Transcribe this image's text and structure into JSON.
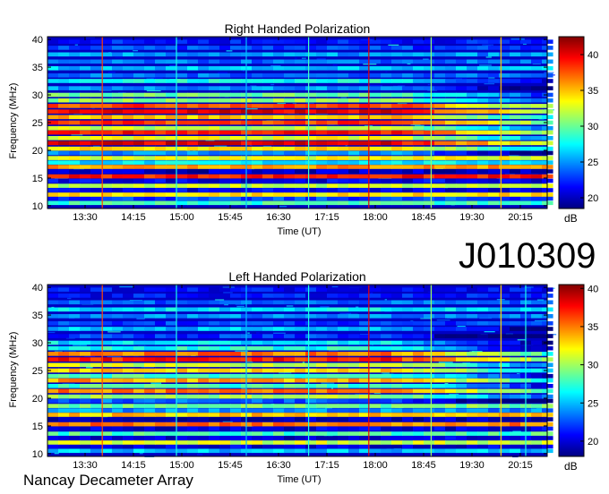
{
  "observation_id": "J010309",
  "footer": "Nancay Decameter Array",
  "colors": {
    "colormap": [
      "#00007f",
      "#0000ff",
      "#007fff",
      "#00ffff",
      "#7fff7f",
      "#ffff00",
      "#ff7f00",
      "#ff0000",
      "#7f0000"
    ]
  },
  "chart_data": [
    {
      "type": "heatmap",
      "title": "Right Handed Polarization",
      "xlabel": "Time (UT)",
      "ylabel": "Frequency (MHz)",
      "colorbar_label": "dB",
      "x_ticks": [
        "13:30",
        "14:15",
        "15:00",
        "15:45",
        "16:30",
        "17:15",
        "18:00",
        "18:45",
        "19:30",
        "20:15"
      ],
      "x_range": [
        "12:55",
        "20:40"
      ],
      "y_ticks": [
        10,
        15,
        20,
        25,
        30,
        35,
        40
      ],
      "y_range": [
        9.5,
        40.5
      ],
      "colorbar_ticks": [
        20,
        25,
        30,
        35,
        40
      ],
      "colorbar_range": [
        18.5,
        42.5
      ],
      "spectral_bands": [
        {
          "freq": 10.5,
          "db": 29
        },
        {
          "freq": 11.3,
          "db": 23
        },
        {
          "freq": 12.0,
          "db": 34
        },
        {
          "freq": 12.8,
          "db": 21
        },
        {
          "freq": 13.6,
          "db": 32
        },
        {
          "freq": 14.5,
          "db": 21
        },
        {
          "freq": 15.3,
          "db": 39
        },
        {
          "freq": 16.2,
          "db": 20
        },
        {
          "freq": 17.0,
          "db": 36
        },
        {
          "freq": 17.8,
          "db": 27
        },
        {
          "freq": 18.6,
          "db": 33
        },
        {
          "freq": 19.5,
          "db": 25
        },
        {
          "freq": 20.3,
          "db": 34
        },
        {
          "freq": 21.3,
          "db": 40
        },
        {
          "freq": 22.2,
          "db": 33
        },
        {
          "freq": 23.2,
          "db": 39
        },
        {
          "freq": 24.0,
          "db": 32
        },
        {
          "freq": 25.0,
          "db": 38
        },
        {
          "freq": 26.0,
          "db": 35
        },
        {
          "freq": 27.0,
          "db": 40
        },
        {
          "freq": 28.0,
          "db": 38
        },
        {
          "freq": 29.0,
          "db": 31
        },
        {
          "freq": 30.0,
          "db": 30
        },
        {
          "freq": 31.2,
          "db": 25
        },
        {
          "freq": 32.5,
          "db": 28
        },
        {
          "freq": 33.5,
          "db": 24
        },
        {
          "freq": 34.8,
          "db": 26
        },
        {
          "freq": 36.0,
          "db": 24
        },
        {
          "freq": 37.3,
          "db": 25
        },
        {
          "freq": 38.5,
          "db": 23
        },
        {
          "freq": 39.6,
          "db": 22
        }
      ],
      "vertical_lines": [
        {
          "time": "13:46",
          "db": 38
        },
        {
          "time": "14:55",
          "db": 28
        },
        {
          "time": "16:00",
          "db": 26
        },
        {
          "time": "16:58",
          "db": 29
        },
        {
          "time": "17:54",
          "db": 40
        },
        {
          "time": "18:52",
          "db": 31
        },
        {
          "time": "19:57",
          "db": 35
        }
      ]
    },
    {
      "type": "heatmap",
      "title": "Left Handed Polarization",
      "xlabel": "Time (UT)",
      "ylabel": "Frequency (MHz)",
      "colorbar_label": "dB",
      "x_ticks": [
        "13:30",
        "14:15",
        "15:00",
        "15:45",
        "16:30",
        "17:15",
        "18:00",
        "18:45",
        "19:30",
        "20:15"
      ],
      "x_range": [
        "12:55",
        "20:40"
      ],
      "y_ticks": [
        10,
        15,
        20,
        25,
        30,
        35,
        40
      ],
      "y_range": [
        9.5,
        40.5
      ],
      "colorbar_ticks": [
        20,
        25,
        30,
        35,
        40
      ],
      "colorbar_range": [
        18,
        40.5
      ],
      "spectral_bands": [
        {
          "freq": 10.5,
          "db": 25
        },
        {
          "freq": 11.3,
          "db": 20
        },
        {
          "freq": 12.0,
          "db": 31
        },
        {
          "freq": 12.8,
          "db": 20
        },
        {
          "freq": 13.6,
          "db": 28
        },
        {
          "freq": 14.5,
          "db": 20
        },
        {
          "freq": 15.3,
          "db": 35
        },
        {
          "freq": 16.2,
          "db": 19
        },
        {
          "freq": 17.0,
          "db": 33
        },
        {
          "freq": 17.8,
          "db": 24
        },
        {
          "freq": 18.6,
          "db": 29
        },
        {
          "freq": 19.5,
          "db": 23
        },
        {
          "freq": 20.3,
          "db": 30
        },
        {
          "freq": 21.3,
          "db": 35
        },
        {
          "freq": 22.2,
          "db": 28
        },
        {
          "freq": 23.2,
          "db": 34
        },
        {
          "freq": 24.0,
          "db": 28
        },
        {
          "freq": 25.0,
          "db": 33
        },
        {
          "freq": 26.0,
          "db": 31
        },
        {
          "freq": 27.0,
          "db": 37
        },
        {
          "freq": 28.0,
          "db": 35
        },
        {
          "freq": 29.0,
          "db": 27
        },
        {
          "freq": 30.0,
          "db": 26
        },
        {
          "freq": 31.2,
          "db": 22
        },
        {
          "freq": 32.5,
          "db": 25
        },
        {
          "freq": 33.5,
          "db": 22
        },
        {
          "freq": 34.8,
          "db": 24
        },
        {
          "freq": 36.0,
          "db": 26
        },
        {
          "freq": 37.3,
          "db": 23
        },
        {
          "freq": 38.5,
          "db": 21
        },
        {
          "freq": 39.6,
          "db": 21
        }
      ],
      "vertical_lines": [
        {
          "time": "13:46",
          "db": 36
        },
        {
          "time": "14:55",
          "db": 27
        },
        {
          "time": "16:00",
          "db": 25
        },
        {
          "time": "16:58",
          "db": 27
        },
        {
          "time": "17:54",
          "db": 38
        },
        {
          "time": "18:52",
          "db": 30
        },
        {
          "time": "19:57",
          "db": 33
        },
        {
          "time": "20:20",
          "db": 27
        }
      ]
    }
  ]
}
